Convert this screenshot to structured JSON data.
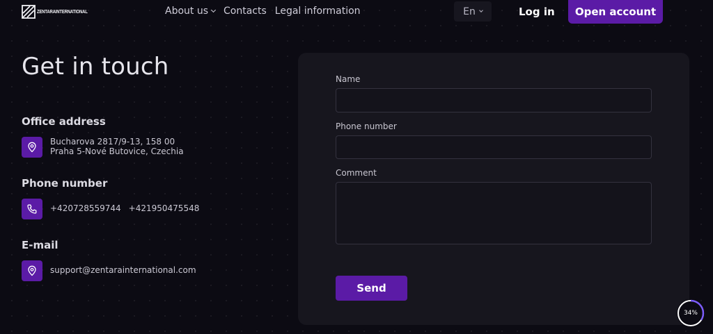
{
  "header": {
    "logo_text": "ZENTARAINTERNATIONAL",
    "nav": [
      {
        "label": "About us",
        "has_dropdown": true
      },
      {
        "label": "Contacts",
        "has_dropdown": false
      },
      {
        "label": "Legal information",
        "has_dropdown": false
      }
    ],
    "language": "En",
    "login_label": "Log in",
    "open_account_label": "Open account"
  },
  "contact": {
    "title": "Get in touch",
    "office": {
      "heading": "Office address",
      "icon": "location-pin-icon",
      "line1": "Bucharova 2817/9-13, 158 00",
      "line2": "Praha 5-Nové Butovice, Czechia"
    },
    "phone": {
      "heading": "Phone number",
      "icon": "phone-icon",
      "numbers": [
        "+420728559744",
        "+421950475548"
      ]
    },
    "email": {
      "heading": "E-mail",
      "icon": "location-pin-icon",
      "address": "support@zentarainternational.com"
    }
  },
  "form": {
    "name_label": "Name",
    "name_value": "",
    "phone_label": "Phone number",
    "phone_value": "",
    "comment_label": "Comment",
    "comment_value": "",
    "send_label": "Send"
  },
  "scroll_progress": {
    "label": "34%",
    "value": 0.34
  },
  "colors": {
    "background": "#0c0b13",
    "card": "#17161e",
    "accent": "#5b1ba6",
    "progress_ring": "#7c5cff"
  }
}
